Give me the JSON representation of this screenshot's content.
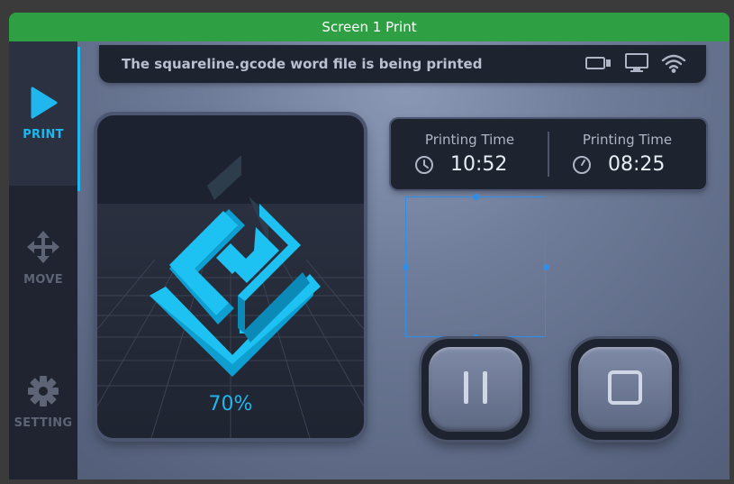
{
  "window": {
    "title": "Screen 1 Print"
  },
  "sidebar": {
    "items": [
      {
        "label": "PRINT",
        "icon": "play-icon",
        "active": true
      },
      {
        "label": "MOVE",
        "icon": "move-icon",
        "active": false
      },
      {
        "label": "SETTING",
        "icon": "gear-icon",
        "active": false
      }
    ]
  },
  "status_bar": {
    "message": "The squareline.gcode word file is being printed",
    "icons": [
      "battery-icon",
      "monitor-icon",
      "wifi-icon"
    ]
  },
  "print_preview": {
    "progress": "70%",
    "progress_value": 0.7
  },
  "times": [
    {
      "label": "Printing Time",
      "value": "10:52",
      "icon": "clock-icon"
    },
    {
      "label": "Printing Time",
      "value": "08:25",
      "icon": "timer-icon"
    }
  ],
  "controls": {
    "pause_icon": "pause-icon",
    "stop_icon": "stop-icon"
  },
  "colors": {
    "accent": "#1fb7ee",
    "titlebar": "#2ea043",
    "panel": "#1e2330",
    "selection": "#2f8fe6"
  }
}
